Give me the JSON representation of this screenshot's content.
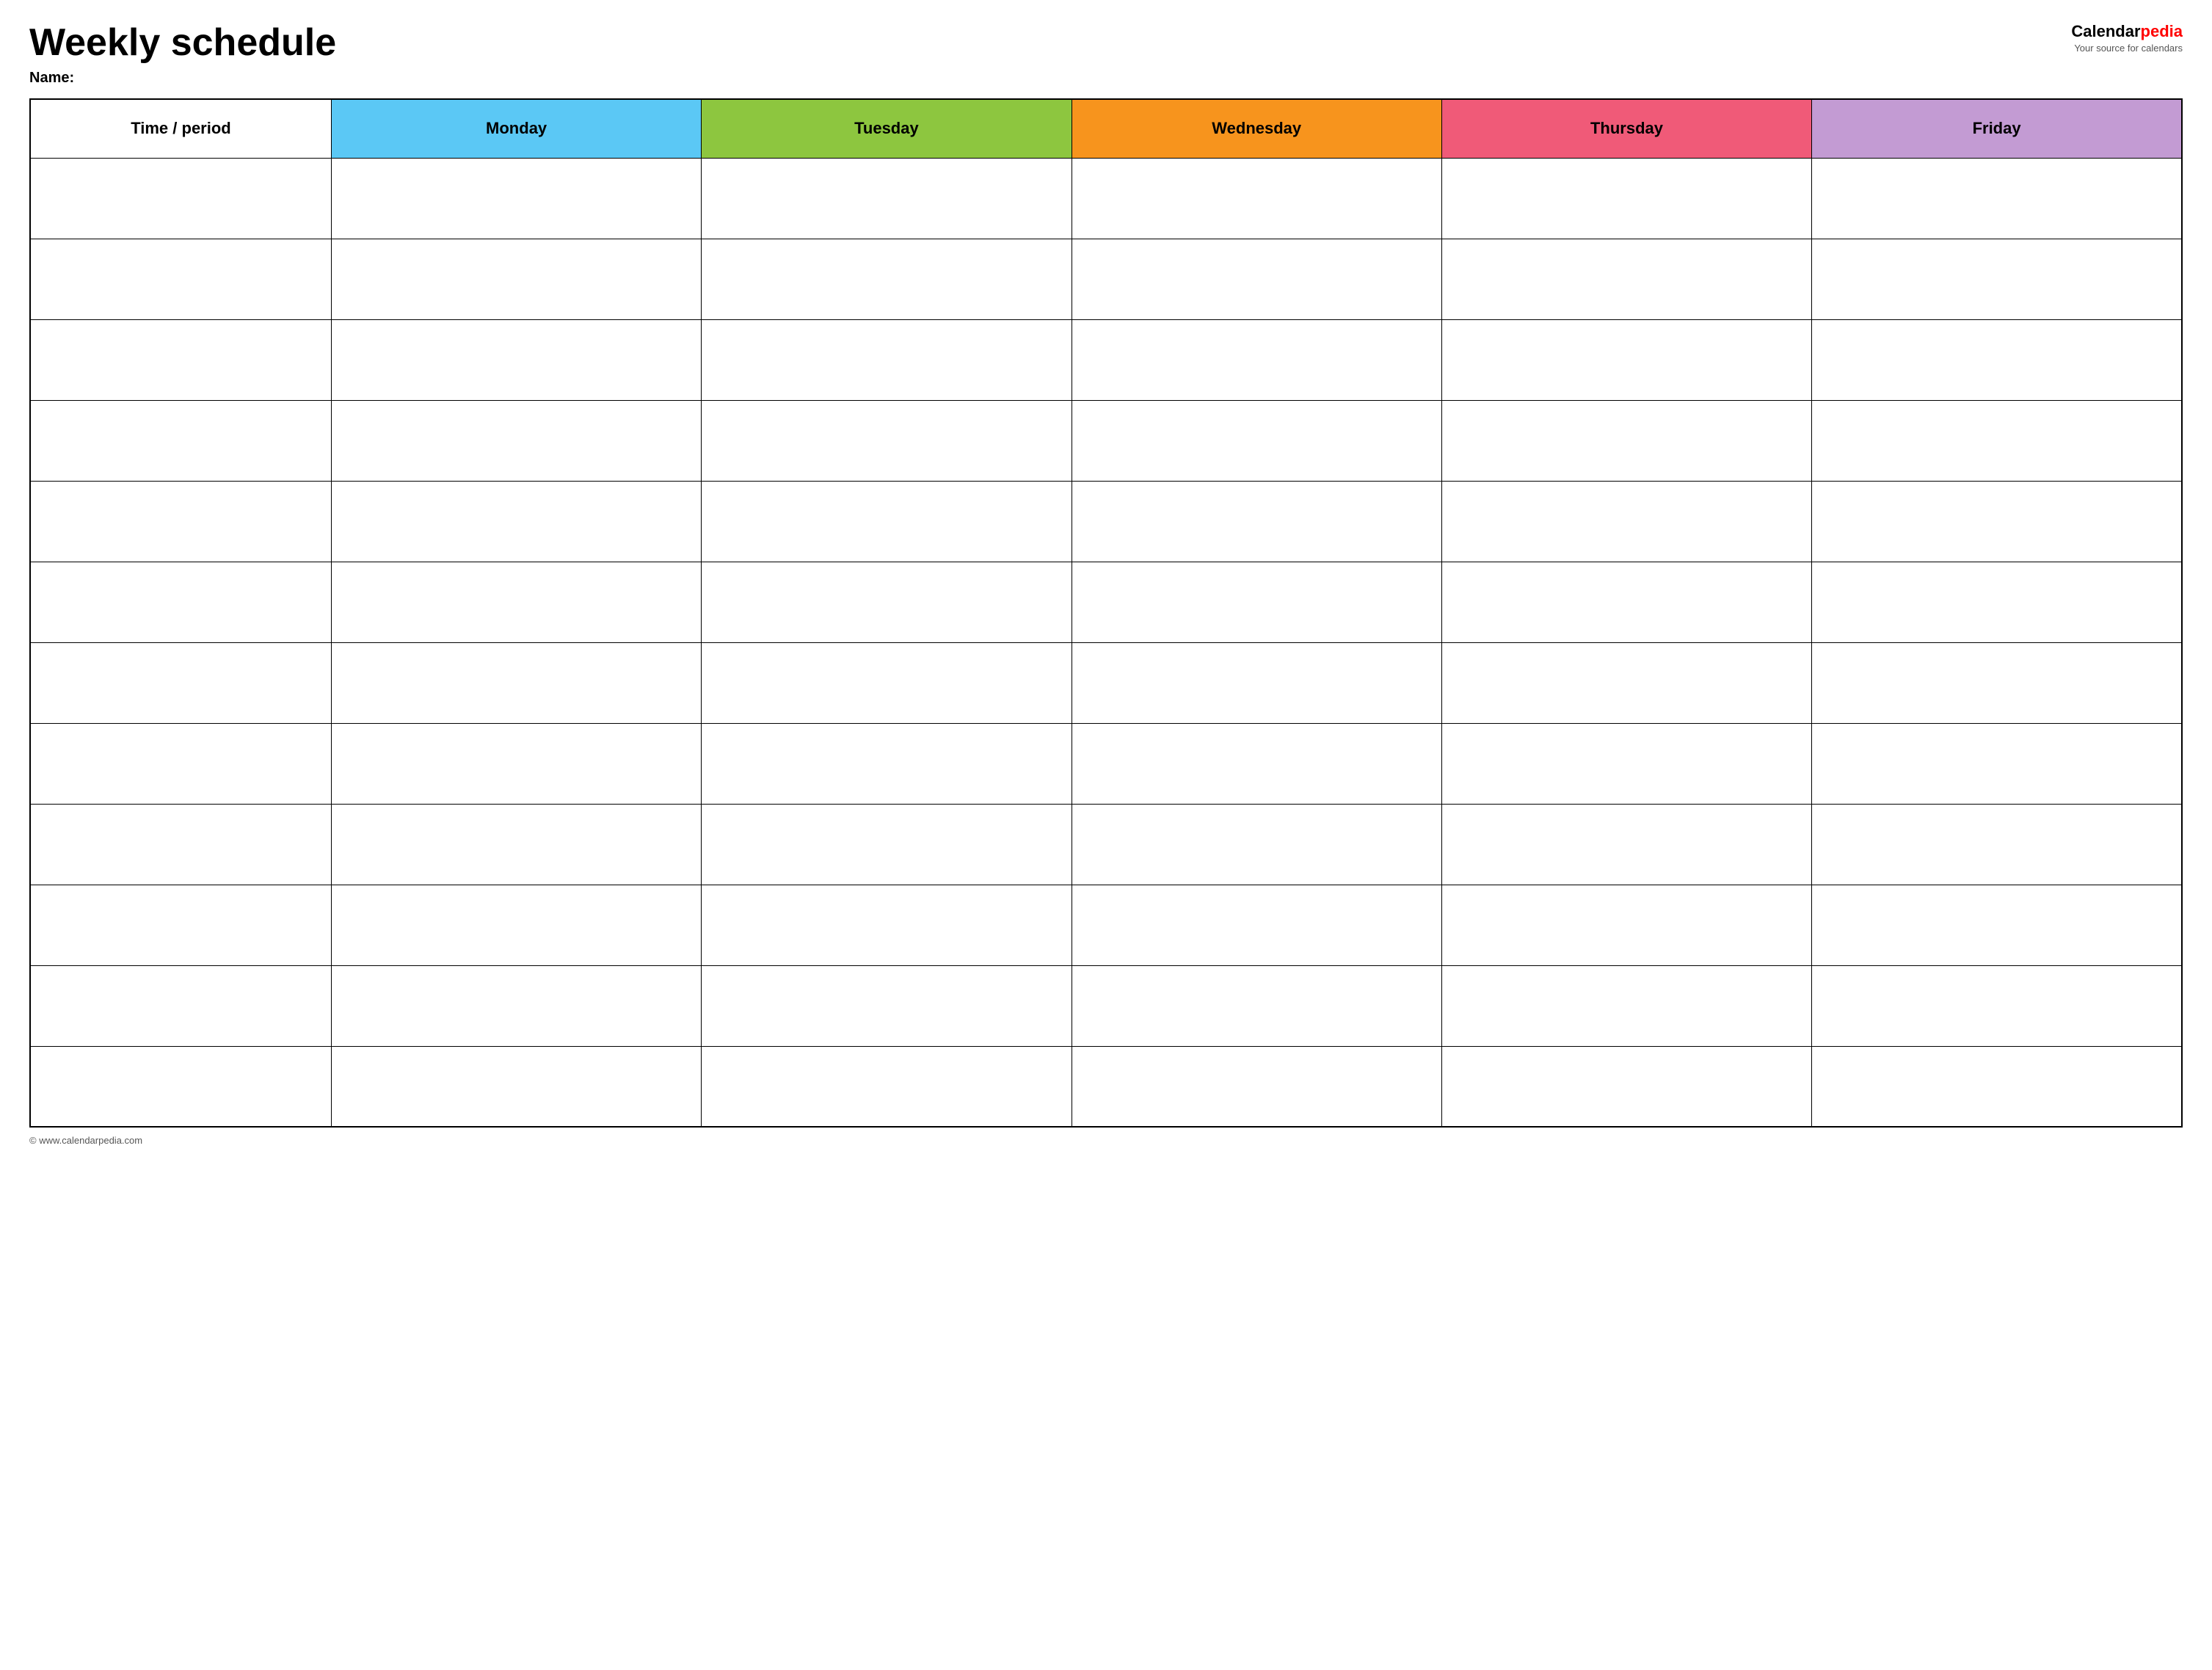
{
  "header": {
    "title": "Weekly schedule",
    "name_label": "Name:",
    "logo": {
      "calendar_part": "Calendar",
      "pedia_part": "pedia",
      "tagline": "Your source for calendars"
    }
  },
  "table": {
    "columns": [
      {
        "id": "time",
        "label": "Time / period",
        "color": "#ffffff",
        "class": "th-time"
      },
      {
        "id": "monday",
        "label": "Monday",
        "color": "#5bc8f5",
        "class": "th-monday"
      },
      {
        "id": "tuesday",
        "label": "Tuesday",
        "color": "#8dc63f",
        "class": "th-tuesday"
      },
      {
        "id": "wednesday",
        "label": "Wednesday",
        "color": "#f7941d",
        "class": "th-wednesday"
      },
      {
        "id": "thursday",
        "label": "Thursday",
        "color": "#f05a78",
        "class": "th-thursday"
      },
      {
        "id": "friday",
        "label": "Friday",
        "color": "#c39bd3",
        "class": "th-friday"
      }
    ],
    "row_count": 12
  },
  "footer": {
    "url": "© www.calendarpedia.com"
  }
}
